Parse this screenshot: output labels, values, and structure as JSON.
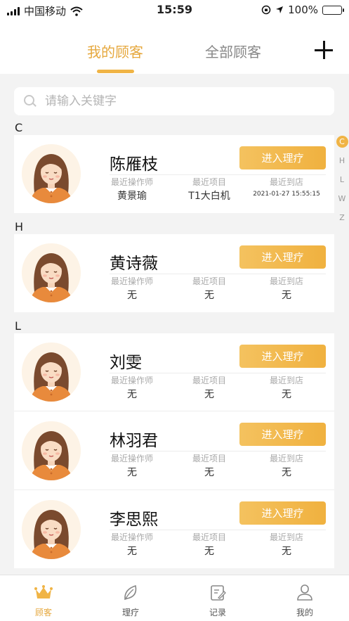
{
  "status_bar": {
    "carrier": "中国移动",
    "time": "15:59",
    "battery": "100%"
  },
  "header": {
    "tabs": [
      {
        "label": "我的顾客"
      },
      {
        "label": "全部顾客"
      }
    ],
    "add_icon": "plus-icon"
  },
  "search": {
    "placeholder": "请输入关键字",
    "value": ""
  },
  "sections": [
    {
      "letter": "C",
      "customers": [
        {
          "name": "陈雁枝",
          "operator": "黄景瑜",
          "item": "T1大白机",
          "visit": "2021-01-27 15:55:15"
        }
      ]
    },
    {
      "letter": "H",
      "customers": [
        {
          "name": "黄诗薇",
          "operator": "无",
          "item": "无",
          "visit": "无"
        }
      ]
    },
    {
      "letter": "L",
      "customers": [
        {
          "name": "刘雯",
          "operator": "无",
          "item": "无",
          "visit": "无"
        },
        {
          "name": "林羽君",
          "operator": "无",
          "item": "无",
          "visit": "无"
        },
        {
          "name": "李思熙",
          "operator": "无",
          "item": "无",
          "visit": "无"
        }
      ]
    }
  ],
  "labels": {
    "operator": "最近操作师",
    "item": "最近项目",
    "visit": "最近到店",
    "enter_button": "进入理疗"
  },
  "index_bar": {
    "letters": [
      "C",
      "H",
      "L",
      "W",
      "Z"
    ],
    "active": "C"
  },
  "tabbar": {
    "items": [
      {
        "label": "顾客",
        "icon": "crown-icon"
      },
      {
        "label": "理疗",
        "icon": "leaf-icon"
      },
      {
        "label": "记录",
        "icon": "notebook-icon"
      },
      {
        "label": "我的",
        "icon": "person-icon"
      }
    ],
    "active_index": 0
  },
  "colors": {
    "accent": "#f0b445",
    "accent_text": "#e6a83e",
    "background": "#f3f3f3"
  }
}
